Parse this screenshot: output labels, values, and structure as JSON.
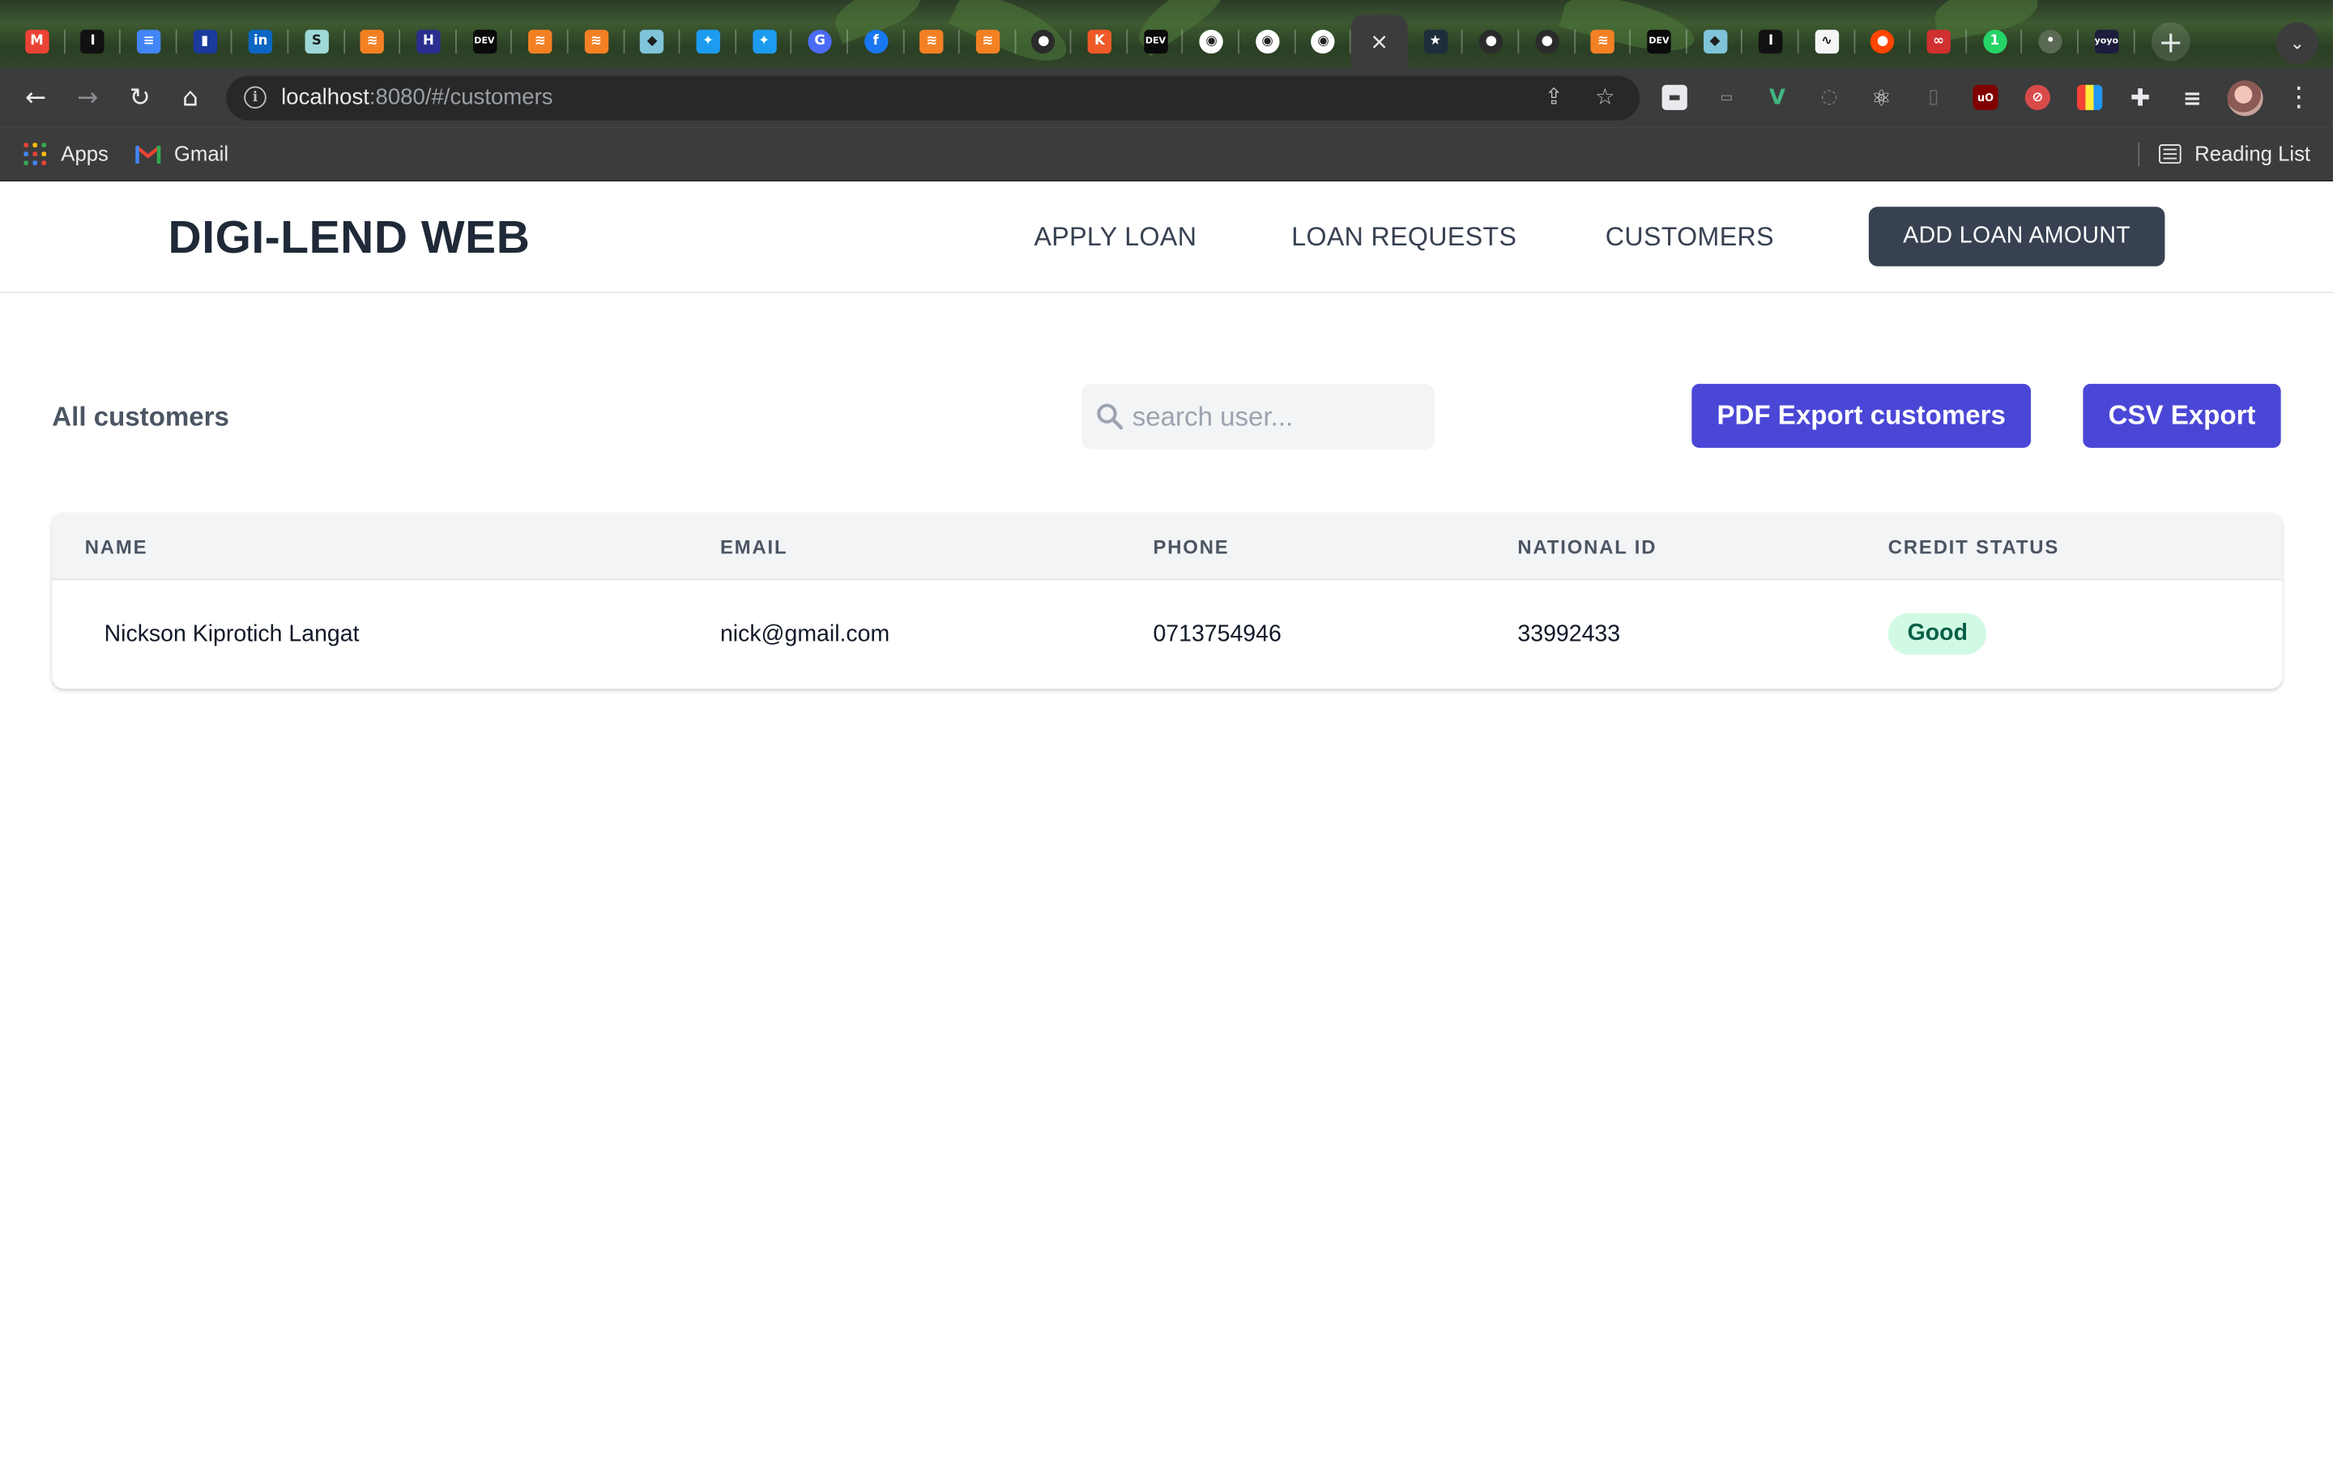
{
  "browser": {
    "tabs": [
      {
        "icon": "gmail-icon",
        "glyph": "M",
        "color": "#ea4335",
        "active": false
      },
      {
        "icon": "instapaper-icon",
        "glyph": "I",
        "color": "#111111",
        "active": false
      },
      {
        "icon": "google-docs-icon",
        "glyph": "≡",
        "color": "#4285f4",
        "active": false
      },
      {
        "icon": "bookmark-icon",
        "glyph": "▮",
        "color": "#1a3a9c",
        "active": false
      },
      {
        "icon": "linkedin-icon",
        "glyph": "in",
        "color": "#0a66c2",
        "active": false
      },
      {
        "icon": "sheets-icon",
        "glyph": "S",
        "color": "#9fd8d8",
        "active": false
      },
      {
        "icon": "stackoverflow-icon",
        "glyph": "≋",
        "color": "#f48024",
        "active": false
      },
      {
        "icon": "wellfound-icon",
        "glyph": "H",
        "color": "#2a2f8f",
        "active": false
      },
      {
        "icon": "dev-to-icon",
        "glyph": "DEV",
        "color": "#0a0a0a",
        "active": false
      },
      {
        "icon": "stackoverflow-icon",
        "glyph": "≋",
        "color": "#f48024",
        "active": false
      },
      {
        "icon": "stackoverflow-icon",
        "glyph": "≋",
        "color": "#f48024",
        "active": false
      },
      {
        "icon": "cube-icon",
        "glyph": "◆",
        "color": "#7fc4d9",
        "active": false
      },
      {
        "icon": "twitter-icon",
        "glyph": "✦",
        "color": "#1d9bf0",
        "active": false
      },
      {
        "icon": "twitter-icon",
        "glyph": "✦",
        "color": "#1d9bf0",
        "active": false
      },
      {
        "icon": "google-icon",
        "glyph": "G",
        "color": "#4a6cf7",
        "active": false
      },
      {
        "icon": "facebook-icon",
        "glyph": "f",
        "color": "#1877f2",
        "active": false
      },
      {
        "icon": "stackoverflow-icon",
        "glyph": "≋",
        "color": "#f48024",
        "active": false
      },
      {
        "icon": "stackoverflow-icon",
        "glyph": "≋",
        "color": "#f48024",
        "active": false
      },
      {
        "icon": "github-icon",
        "glyph": "●",
        "color": "#2b2b2b",
        "active": false
      },
      {
        "icon": "kaggle-icon",
        "glyph": "K",
        "color": "#f05a28",
        "active": false
      },
      {
        "icon": "dev-to-icon",
        "glyph": "DEV",
        "color": "#0a0a0a",
        "active": false
      },
      {
        "icon": "globe-icon",
        "glyph": "◉",
        "color": "#ffffff",
        "active": false
      },
      {
        "icon": "globe-icon",
        "glyph": "◉",
        "color": "#ffffff",
        "active": false
      },
      {
        "icon": "globe-icon",
        "glyph": "◉",
        "color": "#ffffff",
        "active": false
      },
      {
        "icon": "close-icon",
        "glyph": "×",
        "color": "#3c3c3c",
        "active": true
      },
      {
        "icon": "star-icon",
        "glyph": "★",
        "color": "#1f2d3d",
        "active": false
      },
      {
        "icon": "github-icon",
        "glyph": "●",
        "color": "#2b2b2b",
        "active": false
      },
      {
        "icon": "github-icon",
        "glyph": "●",
        "color": "#2b2b2b",
        "active": false
      },
      {
        "icon": "stackoverflow-icon",
        "glyph": "≋",
        "color": "#f48024",
        "active": false
      },
      {
        "icon": "dev-to-icon",
        "glyph": "DEV",
        "color": "#0a0a0a",
        "active": false
      },
      {
        "icon": "cube-icon",
        "glyph": "◆",
        "color": "#7fc4d9",
        "active": false
      },
      {
        "icon": "instapaper-icon",
        "glyph": "I",
        "color": "#111111",
        "active": false
      },
      {
        "icon": "wave-icon",
        "glyph": "∿",
        "color": "#f5f5f5",
        "active": false
      },
      {
        "icon": "reddit-icon",
        "glyph": "●",
        "color": "#ff4500",
        "active": false
      },
      {
        "icon": "link-icon",
        "glyph": "∞",
        "color": "#d03030",
        "active": false
      },
      {
        "icon": "whatsapp-icon",
        "glyph": "1",
        "color": "#25d366",
        "active": false
      },
      {
        "icon": "dot-icon",
        "glyph": "•",
        "color": "#5a6a55",
        "active": false
      },
      {
        "icon": "yoyo-icon",
        "glyph": "yoyo",
        "color": "#1c1c3c",
        "active": false
      }
    ],
    "new_tab_glyph": "+",
    "tab_search_glyph": "⌄",
    "url_host": "localhost",
    "url_rest": ":8080/#/customers",
    "bookmarks": {
      "apps_label": "Apps",
      "gmail_label": "Gmail",
      "reading_list_label": "Reading List"
    }
  },
  "app": {
    "brand": "DIGI-LEND WEB",
    "nav": {
      "apply_loan": "APPLY LOAN",
      "loan_requests": "LOAN REQUESTS",
      "customers": "CUSTOMERS"
    },
    "add_loan_amount": "ADD LOAN AMOUNT",
    "section_title": "All customers",
    "search": {
      "placeholder": "search user...",
      "value": ""
    },
    "pdf_export": "PDF Export customers",
    "csv_export": "CSV Export",
    "table": {
      "headers": {
        "name": "NAME",
        "email": "EMAIL",
        "phone": "PHONE",
        "national_id": "NATIONAL ID",
        "credit_status": "CREDIT STATUS"
      },
      "rows": [
        {
          "name": "Nickson Kiprotich Langat",
          "email": "nick@gmail.com",
          "phone": "0713754946",
          "national_id": "33992433",
          "credit_status": "Good"
        }
      ]
    }
  },
  "colors": {
    "brand_text": "#1f2937",
    "dark_button": "#374151",
    "accent_indigo": "#4b47d6",
    "badge_bg": "#d1fae5",
    "badge_text": "#065f46"
  }
}
